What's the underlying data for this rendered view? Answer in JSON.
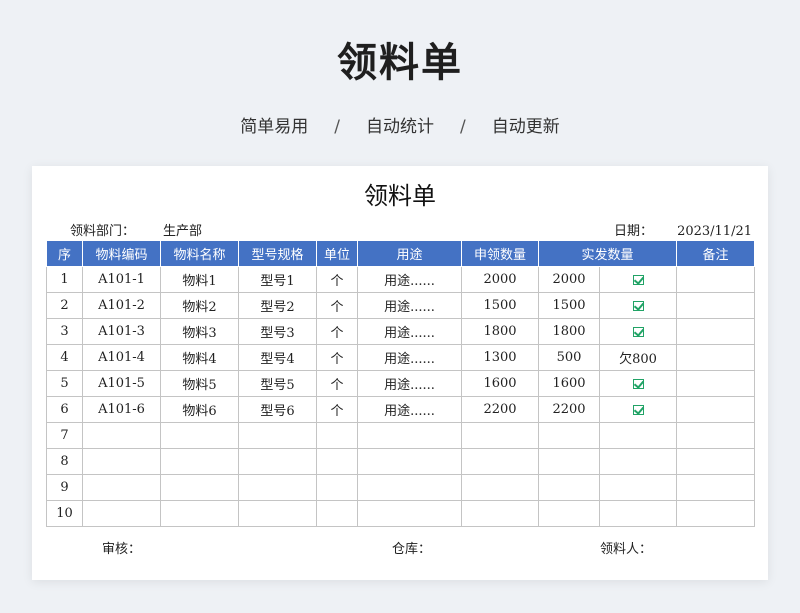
{
  "header": {
    "title": "领料单",
    "taglines": [
      "简单易用",
      "自动统计",
      "自动更新"
    ],
    "separator": "/"
  },
  "sheet": {
    "title": "领料单",
    "department_label": "领料部门：",
    "department_value": "生产部",
    "date_label": "日期：",
    "date_value": "2023/11/21",
    "columns": [
      "序",
      "物料编码",
      "物料名称",
      "型号规格",
      "单位",
      "用途",
      "申领数量",
      "实发数量",
      "备注"
    ],
    "rows": [
      {
        "no": "1",
        "code": "A101-1",
        "name": "物料1",
        "model": "型号1",
        "unit": "个",
        "usage": "用途......",
        "requested": "2000",
        "issued": "2000",
        "status": "check",
        "remark": ""
      },
      {
        "no": "2",
        "code": "A101-2",
        "name": "物料2",
        "model": "型号2",
        "unit": "个",
        "usage": "用途......",
        "requested": "1500",
        "issued": "1500",
        "status": "check",
        "remark": ""
      },
      {
        "no": "3",
        "code": "A101-3",
        "name": "物料3",
        "model": "型号3",
        "unit": "个",
        "usage": "用途......",
        "requested": "1800",
        "issued": "1800",
        "status": "check",
        "remark": ""
      },
      {
        "no": "4",
        "code": "A101-4",
        "name": "物料4",
        "model": "型号4",
        "unit": "个",
        "usage": "用途......",
        "requested": "1300",
        "issued": "500",
        "status": "欠800",
        "remark": ""
      },
      {
        "no": "5",
        "code": "A101-5",
        "name": "物料5",
        "model": "型号5",
        "unit": "个",
        "usage": "用途......",
        "requested": "1600",
        "issued": "1600",
        "status": "check",
        "remark": ""
      },
      {
        "no": "6",
        "code": "A101-6",
        "name": "物料6",
        "model": "型号6",
        "unit": "个",
        "usage": "用途......",
        "requested": "2200",
        "issued": "2200",
        "status": "check",
        "remark": ""
      },
      {
        "no": "7",
        "code": "",
        "name": "",
        "model": "",
        "unit": "",
        "usage": "",
        "requested": "",
        "issued": "",
        "status": "",
        "remark": ""
      },
      {
        "no": "8",
        "code": "",
        "name": "",
        "model": "",
        "unit": "",
        "usage": "",
        "requested": "",
        "issued": "",
        "status": "",
        "remark": ""
      },
      {
        "no": "9",
        "code": "",
        "name": "",
        "model": "",
        "unit": "",
        "usage": "",
        "requested": "",
        "issued": "",
        "status": "",
        "remark": ""
      },
      {
        "no": "10",
        "code": "",
        "name": "",
        "model": "",
        "unit": "",
        "usage": "",
        "requested": "",
        "issued": "",
        "status": "",
        "remark": ""
      }
    ],
    "footer": {
      "reviewer_label": "审核：",
      "warehouse_label": "仓库：",
      "receiver_label": "领料人："
    }
  },
  "colors": {
    "header_fill": "#4472c4",
    "check_icon": "#21a366",
    "background": "#eef1f5"
  }
}
